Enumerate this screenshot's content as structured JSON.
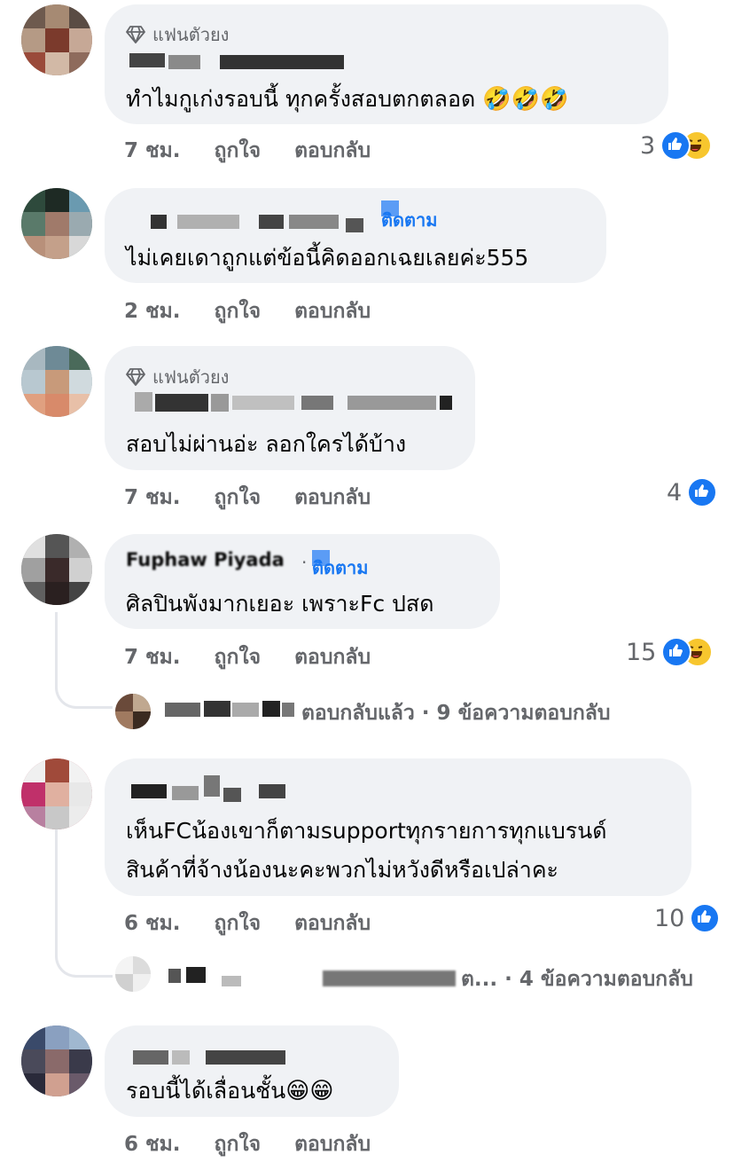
{
  "colors": {
    "bubble": "#f0f2f5",
    "meta": "#65676b",
    "like": "#1877f2",
    "follow": "#1877f2"
  },
  "icons": {
    "top_fan": "diamond-icon",
    "like": "like-icon",
    "haha": "haha-icon"
  },
  "comments": [
    {
      "badge": "แฟนตัวยง",
      "text": "ทำไมกูเก่งรอบนี้ ทุกครั้งสอบตกตลอด",
      "emoji": "🤣🤣🤣",
      "time": "7 ชม.",
      "like": "ถูกใจ",
      "reply": "ตอบกลับ",
      "reactions": "3"
    },
    {
      "follow": "ติดตาม",
      "text": "ไม่เคยเดาถูกแต่ข้อนี้คิดออกเฉยเลยค่ะ555",
      "time": "2 ชม.",
      "like": "ถูกใจ",
      "reply": "ตอบกลับ"
    },
    {
      "badge": "แฟนตัวยง",
      "text": "สอบไม่ผ่านอ่ะ ลอกใครได้บ้าง",
      "time": "7 ชม.",
      "like": "ถูกใจ",
      "reply": "ตอบกลับ",
      "reactions": "4"
    },
    {
      "name": "Fuphaw Piyada",
      "sep": "·",
      "follow": "ติดตาม",
      "text": "ศิลปินพังมากเยอะ เพราะFc ปสด",
      "time": "7 ชม.",
      "like": "ถูกใจ",
      "reply": "ตอบกลับ",
      "reactions": "15",
      "replies_summary": "ตอบกลับแล้ว · 9 ข้อความตอบกลับ"
    },
    {
      "text_line1": "เห็นFCน้องเขาก็ตามsupportทุกรายการทุกแบรนด์",
      "text_line2": "สินค้าที่จ้างน้องนะคะพวกไม่หวังดีหรือเปล่าคะ",
      "time": "6 ชม.",
      "like": "ถูกใจ",
      "reply": "ตอบกลับ",
      "reactions": "10",
      "replies_summary": "ต... · 4 ข้อความตอบกลับ"
    },
    {
      "text": "รอบนี้ได้เลื่อนชั้น",
      "emoji": "😁😁",
      "time": "6 ชม.",
      "like": "ถูกใจ",
      "reply": "ตอบกลับ"
    }
  ]
}
